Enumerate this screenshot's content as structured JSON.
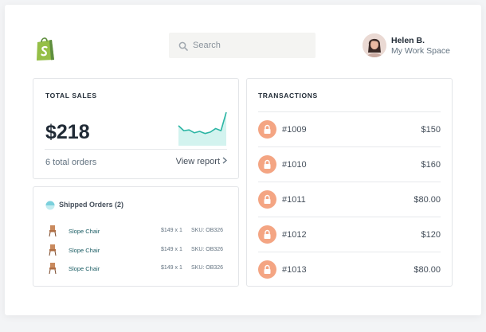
{
  "header": {
    "logo_icon": "shopping-bag-logo-icon",
    "search": {
      "placeholder": "Search",
      "value": "",
      "icon": "search-icon"
    },
    "user": {
      "name": "Helen B.",
      "workspace": "My Work Space",
      "avatar_icon": "user-avatar"
    }
  },
  "sales": {
    "title": "TOTAL SALES",
    "value": "$218",
    "orders": "6 total orders",
    "view_report": "View report",
    "sparkline_color": "#2bb5a4",
    "sparkline_fill": "#d3f3ef",
    "sparkline_values": [
      52,
      38,
      40,
      32,
      36,
      30,
      34,
      44,
      38,
      90
    ]
  },
  "shipped": {
    "title": "Shipped Orders (2)",
    "rows": [
      {
        "name": "Slope Chair",
        "price": "$149 x 1",
        "sku": "SKU: OB326"
      },
      {
        "name": "Slope Chair",
        "price": "$149 x 1",
        "sku": "SKU: OB326"
      },
      {
        "name": "Slope Chair",
        "price": "$149 x 1",
        "sku": "SKU: OB326"
      }
    ]
  },
  "transactions": {
    "title": "TRANSACTIONS",
    "icon_color": "#f4a583",
    "rows": [
      {
        "id": "#1009",
        "amount": "$150"
      },
      {
        "id": "#1010",
        "amount": "$160"
      },
      {
        "id": "#1011",
        "amount": "$80.00"
      },
      {
        "id": "#1012",
        "amount": "$120"
      },
      {
        "id": "#1013",
        "amount": "$80.00"
      }
    ]
  }
}
